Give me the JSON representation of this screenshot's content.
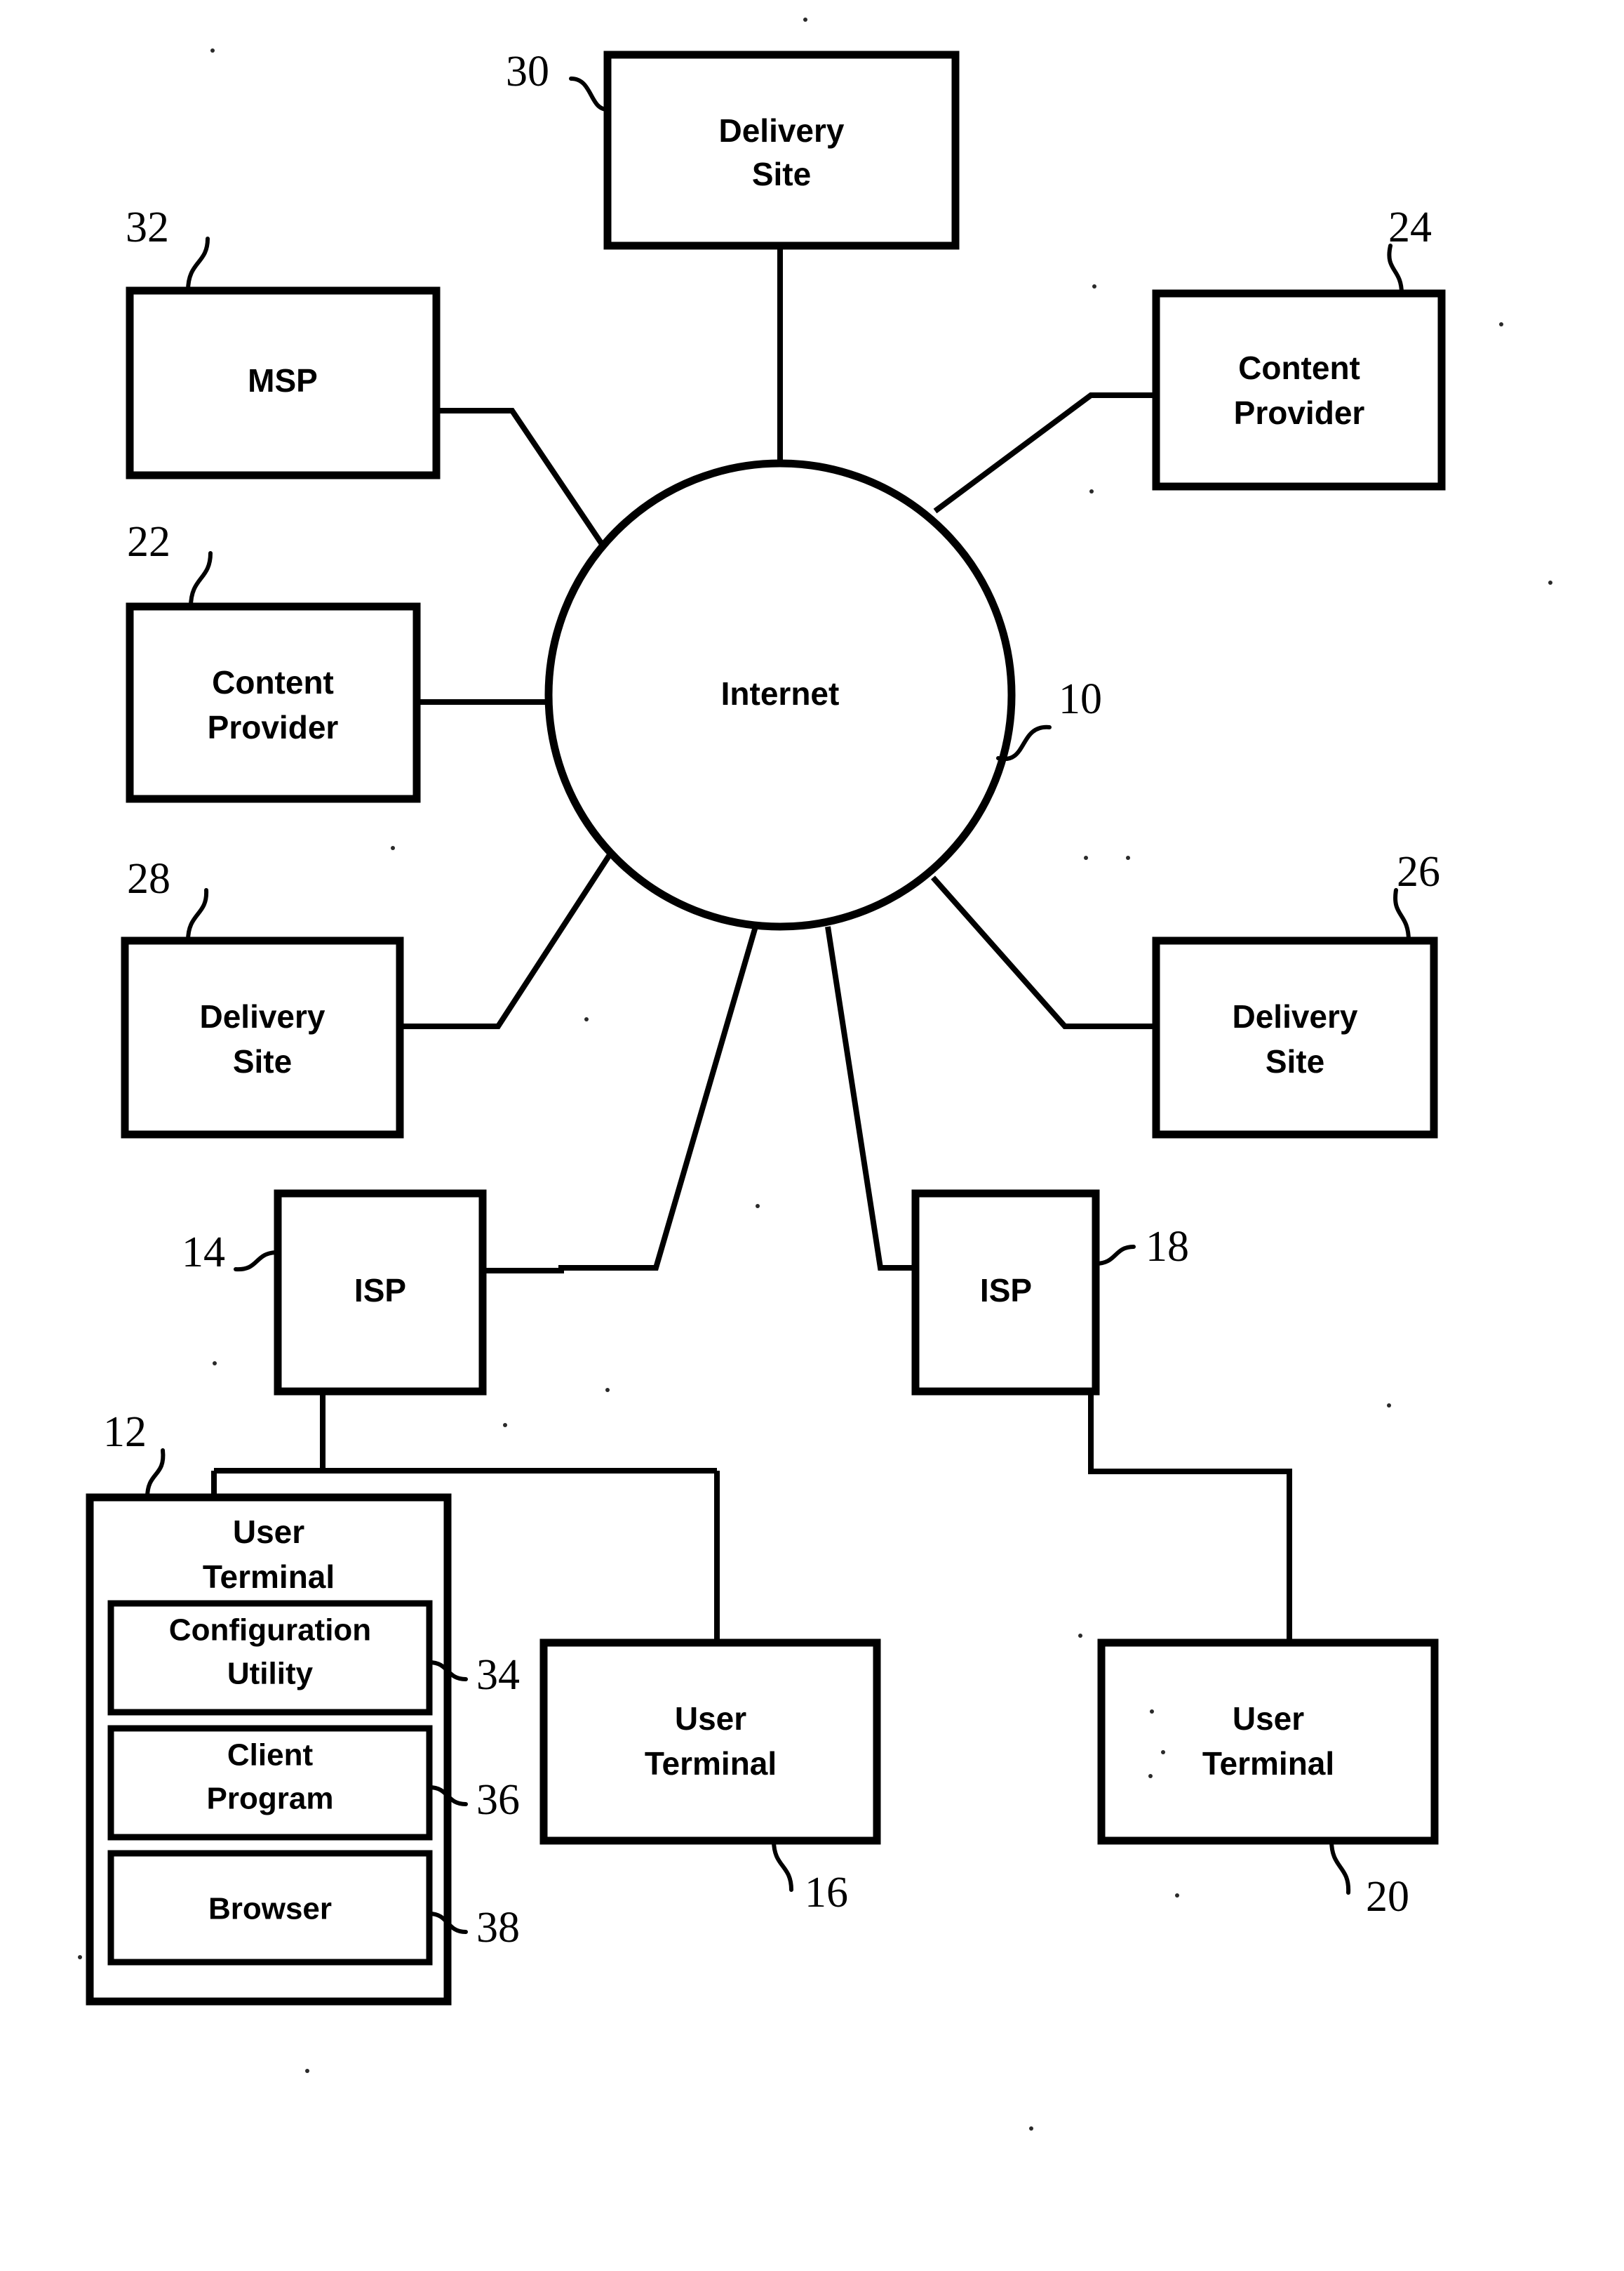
{
  "figure": {
    "type": "patent-network-diagram",
    "background_color": "#ffffff",
    "line_color": "#000000"
  },
  "nodes": {
    "delivery_site_top": {
      "label_line1": "Delivery",
      "label_line2": "Site",
      "ref": "30"
    },
    "msp": {
      "label_line1": "MSP",
      "label_line2": "",
      "ref": "32"
    },
    "content_provider_right": {
      "label_line1": "Content",
      "label_line2": "Provider",
      "ref": "24"
    },
    "content_provider_left": {
      "label_line1": "Content",
      "label_line2": "Provider",
      "ref": "22"
    },
    "internet": {
      "label_line1": "Internet",
      "label_line2": "",
      "ref": "10"
    },
    "delivery_site_left": {
      "label_line1": "Delivery",
      "label_line2": "Site",
      "ref": "28"
    },
    "delivery_site_right": {
      "label_line1": "Delivery",
      "label_line2": "Site",
      "ref": "26"
    },
    "isp_left": {
      "label_line1": "ISP",
      "label_line2": "",
      "ref": "14"
    },
    "isp_right": {
      "label_line1": "ISP",
      "label_line2": "",
      "ref": "18"
    },
    "user_terminal_main": {
      "label_line1": "User",
      "label_line2": "Terminal",
      "ref": "12"
    },
    "user_terminal_mid": {
      "label_line1": "User",
      "label_line2": "Terminal",
      "ref": "16"
    },
    "user_terminal_right": {
      "label_line1": "User",
      "label_line2": "Terminal",
      "ref": "20"
    },
    "configuration_utility": {
      "label_line1": "Configuration",
      "label_line2": "Utility",
      "ref": "34"
    },
    "client_program": {
      "label_line1": "Client",
      "label_line2": "Program",
      "ref": "36"
    },
    "browser": {
      "label_line1": "Browser",
      "label_line2": "",
      "ref": "38"
    }
  }
}
